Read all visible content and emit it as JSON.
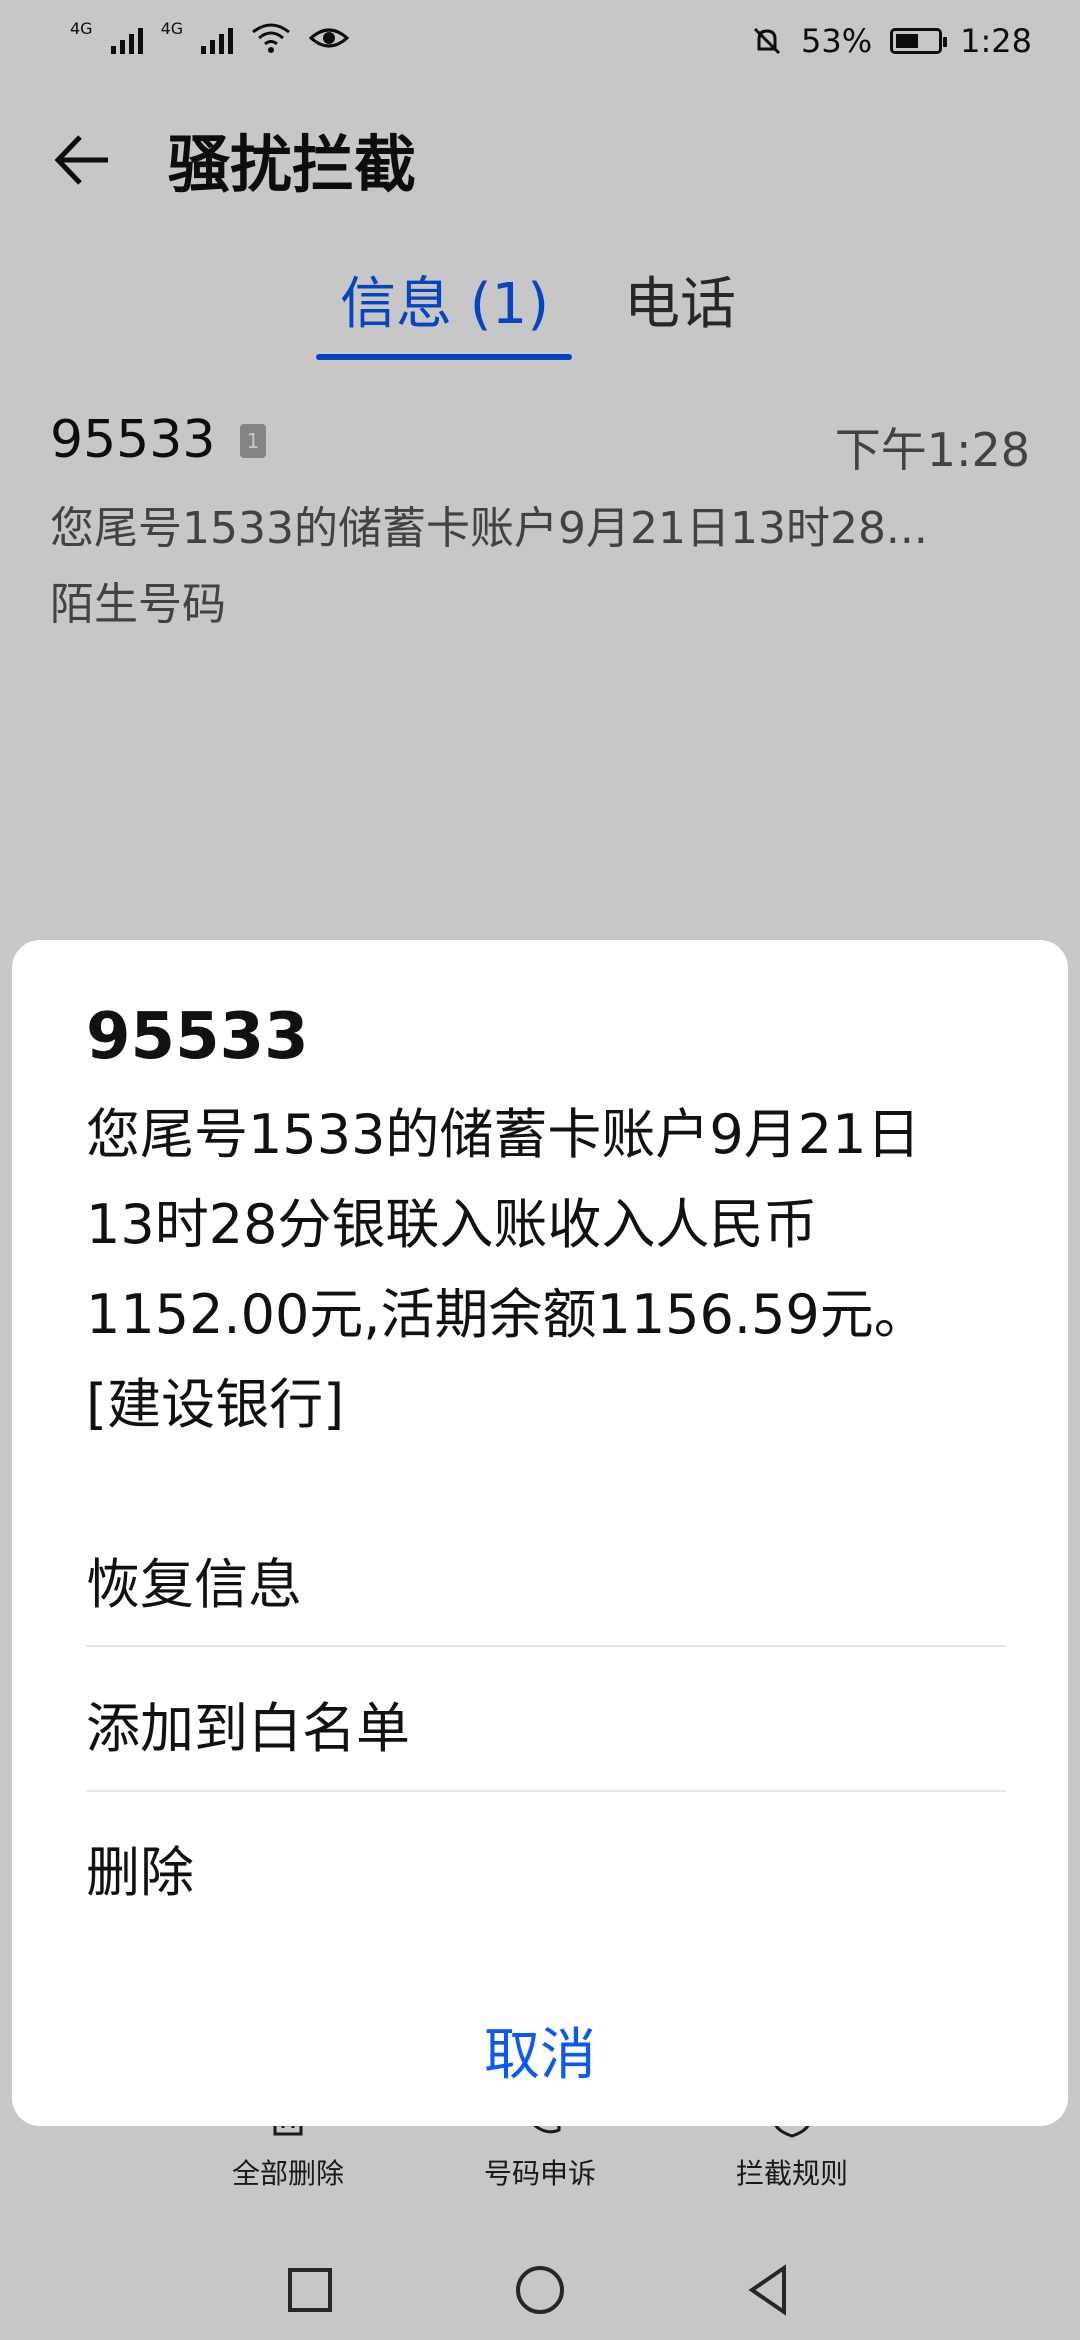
{
  "status_bar": {
    "sim1_label": "4G",
    "sim2_label": "4G",
    "battery": "53%",
    "time": "1:28",
    "icons": [
      "signal-icon",
      "signal-icon",
      "wifi-icon",
      "eye-icon",
      "mute-bell-icon",
      "battery-icon"
    ]
  },
  "app_bar": {
    "title": "骚扰拦截"
  },
  "tabs": [
    {
      "label": "信息 (1)",
      "active": true
    },
    {
      "label": "电话",
      "active": false
    }
  ],
  "colors": {
    "accent": "#0a59f7",
    "text_primary": "#111111",
    "text_secondary": "#555555"
  },
  "messages": [
    {
      "sender": "95533",
      "sim_badge": "1",
      "time": "下午1:28",
      "preview": "您尾号1533的储蓄卡账户9月21日13时28...",
      "tag": "陌生号码"
    }
  ],
  "toolbar": {
    "items": [
      {
        "label": "全部删除",
        "icon": "trash-icon"
      },
      {
        "label": "号码申诉",
        "icon": "phone-icon"
      },
      {
        "label": "拦截规则",
        "icon": "shield-icon"
      }
    ]
  },
  "dialog": {
    "title": "95533",
    "body": "您尾号1533的储蓄卡账户9月21日13时28分银联入账收入人民币1152.00元,活期余额1156.59元。[建设银行]",
    "options": [
      "恢复信息",
      "添加到白名单",
      "删除"
    ],
    "cancel": "取消"
  }
}
